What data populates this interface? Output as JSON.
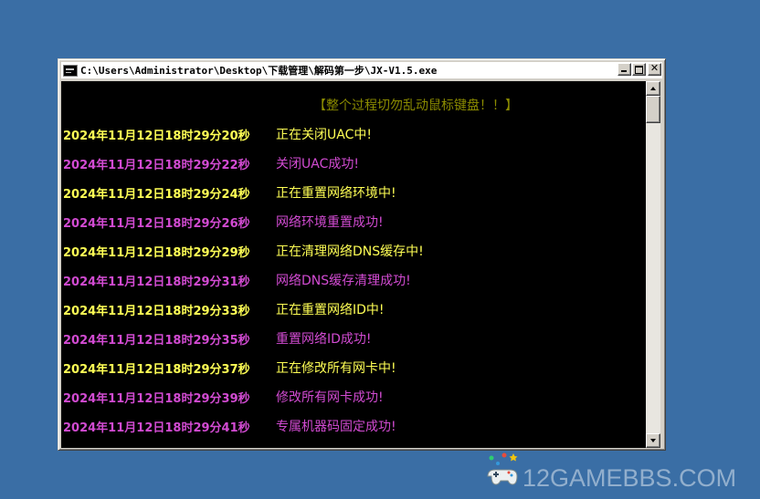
{
  "window": {
    "title": "C:\\Users\\Administrator\\Desktop\\下载管理\\解码第一步\\JX-V1.5.exe",
    "icon": "console-app-icon",
    "buttons": [
      "minimize",
      "maximize",
      "close"
    ]
  },
  "console": {
    "header": "【整个过程切勿乱动鼠标键盘！！】",
    "header_color": "#8b8b00",
    "colors": {
      "yellow": "#ffff55",
      "magenta": "#d24bd2",
      "background": "#000000"
    },
    "lines": [
      {
        "time": "2024年11月12日18时29分20秒",
        "message": "正在关闭UAC中!",
        "color": "yellow"
      },
      {
        "time": "2024年11月12日18时29分22秒",
        "message": "关闭UAC成功!",
        "color": "magenta"
      },
      {
        "time": "2024年11月12日18时29分24秒",
        "message": "正在重置网络环境中!",
        "color": "yellow"
      },
      {
        "time": "2024年11月12日18时29分26秒",
        "message": "网络环境重置成功!",
        "color": "magenta"
      },
      {
        "time": "2024年11月12日18时29分29秒",
        "message": "正在清理网络DNS缓存中!",
        "color": "yellow"
      },
      {
        "time": "2024年11月12日18时29分31秒",
        "message": "网络DNS缓存清理成功!",
        "color": "magenta"
      },
      {
        "time": "2024年11月12日18时29分33秒",
        "message": "正在重置网络ID中!",
        "color": "yellow"
      },
      {
        "time": "2024年11月12日18时29分35秒",
        "message": "重置网络ID成功!",
        "color": "magenta"
      },
      {
        "time": "2024年11月12日18时29分37秒",
        "message": "正在修改所有网卡中!",
        "color": "yellow"
      },
      {
        "time": "2024年11月12日18时29分39秒",
        "message": "修改所有网卡成功!",
        "color": "magenta"
      },
      {
        "time": "2024年11月12日18时29分41秒",
        "message": "专属机器码固定成功!",
        "color": "magenta"
      }
    ]
  },
  "watermark": {
    "text": "12GAMEBBS.COM",
    "icon": "gamepad-icon"
  },
  "desktop": {
    "background": "#3a6ea5"
  }
}
